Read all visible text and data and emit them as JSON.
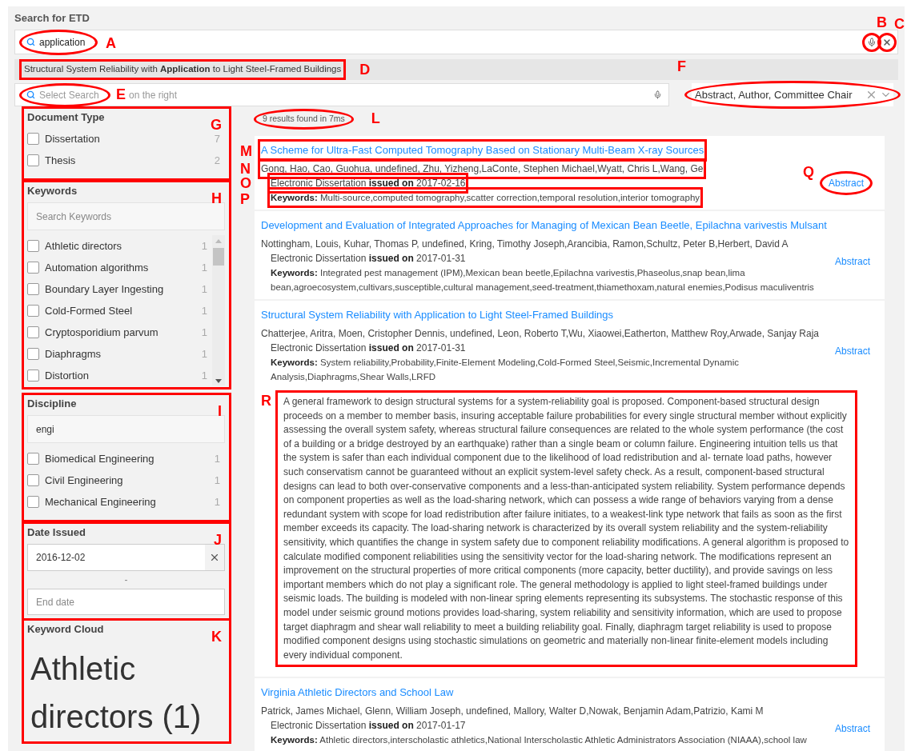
{
  "title": "Search for ETD",
  "search": {
    "value": "application",
    "annotation": {
      "letter": "A",
      "kind": "ellipse"
    },
    "mic_annotation": {
      "letter": "B",
      "kind": "ellipse"
    },
    "clear_annotation": {
      "letter": "C",
      "kind": "ellipse"
    }
  },
  "suggestion": {
    "text": "Structural System Reliability with **Application** to Light Steel-Framed Buildings",
    "annotation": {
      "letter": "D",
      "kind": "box"
    }
  },
  "field_search": {
    "placeholder": "Select Search",
    "hint_rest": "on the right",
    "annotation": {
      "letter": "E",
      "kind": "ellipse"
    }
  },
  "field_select": {
    "value": "Abstract, Author, Committee Chair",
    "annotation": {
      "letter": "F",
      "kind": "ellipse"
    }
  },
  "facets": [
    {
      "kind": "list",
      "title": "Document Type",
      "annotation": {
        "letter": "G",
        "kind": "box"
      },
      "items": [
        {
          "label": "Dissertation",
          "count": "7",
          "checked": false
        },
        {
          "label": "Thesis",
          "count": "2",
          "checked": false
        }
      ]
    },
    {
      "kind": "search_list",
      "title": "Keywords",
      "placeholder": "Search Keywords",
      "annotation": {
        "letter": "H",
        "kind": "box"
      },
      "items": [
        {
          "label": "Athletic directors",
          "count": "1",
          "checked": false
        },
        {
          "label": "Automation algorithms",
          "count": "1",
          "checked": false
        },
        {
          "label": "Boundary Layer Ingesting",
          "count": "1",
          "checked": false
        },
        {
          "label": "Cold-Formed Steel",
          "count": "1",
          "checked": false
        },
        {
          "label": "Cryptosporidium parvum",
          "count": "1",
          "checked": false
        },
        {
          "label": "Diaphragms",
          "count": "1",
          "checked": false
        },
        {
          "label": "Distortion",
          "count": "1",
          "checked": false
        }
      ]
    },
    {
      "kind": "search_list",
      "title": "Discipline",
      "value": "engi",
      "annotation": {
        "letter": "I",
        "kind": "box"
      },
      "items": [
        {
          "label": "Biomedical Engineering",
          "count": "1",
          "checked": false
        },
        {
          "label": "Civil Engineering",
          "count": "1",
          "checked": false
        },
        {
          "label": "Mechanical Engineering",
          "count": "1",
          "checked": false
        }
      ]
    },
    {
      "kind": "date",
      "title": "Date Issued",
      "start": "2016-12-02",
      "separator": "-",
      "end_placeholder": "End date",
      "annotation": {
        "letter": "J",
        "kind": "box"
      }
    },
    {
      "kind": "cloud",
      "title": "Keyword Cloud",
      "words": [
        "Athletic directors (1)"
      ],
      "annotation": {
        "letter": "K",
        "kind": "box"
      }
    }
  ],
  "results_count": {
    "text": "9 results found in 7ms",
    "annotation": {
      "letter": "L",
      "kind": "ellipse"
    }
  },
  "results": [
    {
      "title": "A Scheme for Ultra-Fast Computed Tomography Based on Stationary Multi-Beam X-ray Sources",
      "authors": "Gong, Hao, Cao, Guohua, undefined, Zhu, Yizheng,LaConte, Stephen Michael,Wyatt, Chris L,Wang, Ge",
      "doc_type": "Electronic Dissertation",
      "issued_label": "issued on",
      "date": "2017-02-16",
      "link": "Abstract",
      "keywords_label": "Keywords:",
      "keywords": "Multi-source,computed tomography,scatter correction,temporal resolution,interior tomography",
      "expanded": false,
      "annotations": {
        "title": {
          "letter": "M",
          "kind": "box"
        },
        "authors": {
          "letter": "N",
          "kind": "box"
        },
        "issued": {
          "letter": "O",
          "kind": "box"
        },
        "keywords": {
          "letter": "P",
          "kind": "box"
        },
        "link": {
          "letter": "Q",
          "kind": "ellipse"
        }
      }
    },
    {
      "title": "Development and Evaluation of Integrated Approaches for Managing of Mexican Bean Beetle, Epilachna varivestis Mulsant",
      "authors": "Nottingham, Louis, Kuhar, Thomas P, undefined, Kring, Timothy Joseph,Arancibia, Ramon,Schultz, Peter B,Herbert, David A",
      "doc_type": "Electronic Dissertation",
      "issued_label": "issued on",
      "date": "2017-01-31",
      "link": "Abstract",
      "keywords_label": "Keywords:",
      "keywords": "Integrated pest management (IPM),Mexican bean beetle,Epilachna varivestis,Phaseolus,snap bean,lima bean,agroecosystem,cultivars,susceptible,cultural management,seed-treatment,thiamethoxam,natural enemies,Podisus maculiventris",
      "expanded": false
    },
    {
      "title": "Structural System Reliability with Application to Light Steel-Framed Buildings",
      "authors": "Chatterjee, Aritra, Moen, Cristopher Dennis, undefined, Leon, Roberto T,Wu, Xiaowei,Eatherton, Matthew Roy,Arwade, Sanjay Raja",
      "doc_type": "Electronic Dissertation",
      "issued_label": "issued on",
      "date": "2017-01-31",
      "link": "Abstract",
      "keywords_label": "Keywords:",
      "keywords": "System reliability,Probability,Finite-Element Modeling,Cold-Formed Steel,Seismic,Incremental Dynamic Analysis,Diaphragms,Shear Walls,LRFD",
      "expanded": true,
      "abstract": "A general framework to design structural systems for a system-reliability goal is proposed. Component-based structural design proceeds on a member to member basis, insuring acceptable failure probabilities for every single structural member without explicitly assessing the overall system safety, whereas structural failure consequences are related to the whole system performance (the cost of a building or a bridge destroyed by an earthquake) rather than a single beam or column failure. Engineering intuition tells us that the system is safer than each individual component due to the likelihood of load redistribution and al- ternate load paths, however such conservatism cannot be guaranteed without an explicit system-level safety check. As a result, component-based structural designs can lead to both over-conservative components and a less-than-anticipated system reliability. System performance depends on component properties as well as the load-sharing network, which can possess a wide range of behaviors varying from a dense redundant system with scope for load redistribution after failure initiates, to a weakest-link type network that fails as soon as the first member exceeds its capacity. The load-sharing network is characterized by its overall system reliability and the system-reliability sensitivity, which quantifies the change in system safety due to component reliability modifications. A general algorithm is proposed to calculate modified component reliabilities using the sensitivity vector for the load-sharing network. The modifications represent an improvement on the structural properties of more critical components (more capacity, better ductility), and provide savings on less important members which do not play a significant role. The general methodology is applied to light steel-framed buildings under seismic loads. The building is modeled with non-linear spring elements representing its subsystems. The stochastic response of this model under seismic ground motions provides load-sharing, system reliability and sensitivity information, which are used to propose target diaphragm and shear wall reliability to meet a building reliability goal. Finally, diaphragm target reliability is used to propose modified component designs using stochastic simulations on geometric and materially non-linear finite-element models including every individual component.",
      "annotations": {
        "abstract": {
          "letter": "R",
          "kind": "box"
        }
      }
    },
    {
      "title": "Virginia Athletic Directors and School Law",
      "authors": "Patrick, James Michael, Glenn, William Joseph, undefined, Mallory, Walter D,Nowak, Benjamin Adam,Patrizio, Kami M",
      "doc_type": "Electronic Dissertation",
      "issued_label": "issued on",
      "date": "2017-01-17",
      "link": "Abstract",
      "keywords_label": "Keywords:",
      "keywords": "Athletic directors,interscholastic athletics,National Interscholastic Athletic Administrators Association (NIAAA),school law",
      "expanded": false
    }
  ]
}
